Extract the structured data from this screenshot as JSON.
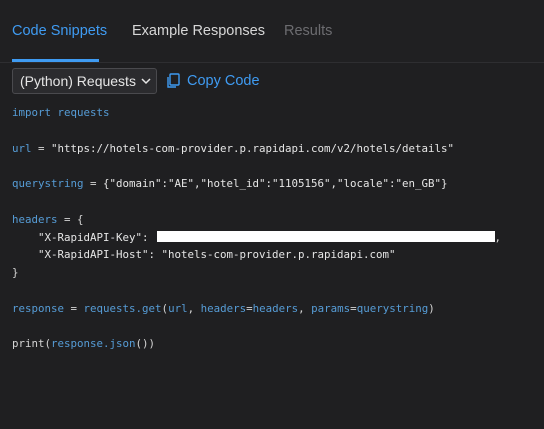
{
  "tabs": [
    {
      "label": "Code Snippets",
      "state": "active"
    },
    {
      "label": "Example Responses",
      "state": "normal"
    },
    {
      "label": "Results",
      "state": "disabled"
    }
  ],
  "toolbar": {
    "language_select": "(Python) Requests",
    "copy_label": "Copy Code"
  },
  "code": {
    "import_kw": "import",
    "import_mod": "requests",
    "url_var": "url",
    "url_value": "\"https://hotels-com-provider.p.rapidapi.com/v2/hotels/details\"",
    "qs_var": "querystring",
    "qs_value": "{\"domain\":\"AE\",\"hotel_id\":\"1105156\",\"locale\":\"en_GB\"}",
    "headers_var": "headers",
    "headers_open": "{",
    "key_header": "\"X-RapidAPI-Key\":",
    "host_header": "\"X-RapidAPI-Host\":",
    "host_value": "\"hotels-com-provider.p.rapidapi.com\"",
    "headers_close": "}",
    "resp_var": "response",
    "call_fn": "requests.get",
    "arg_url": "url",
    "arg_headers_k": "headers",
    "arg_headers_v": "headers",
    "arg_params_k": "params",
    "arg_params_v": "querystring",
    "print_fn": "print",
    "print_arg": "response.json"
  },
  "colors": {
    "accent": "#3f9bf2",
    "keyword": "#569cd6",
    "background": "#1f1f21"
  }
}
